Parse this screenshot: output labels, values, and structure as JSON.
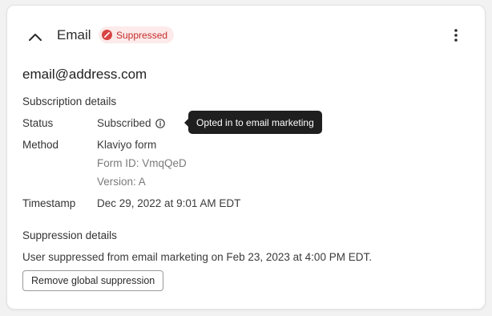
{
  "header": {
    "title": "Email",
    "badge_label": "Suppressed",
    "badge_color": "#c62c2c",
    "badge_background": "#fdeaea",
    "collapse_icon": "chevron-up-icon",
    "menu_icon": "more-vertical-icon"
  },
  "profile": {
    "email": "email@address.com"
  },
  "subscription": {
    "heading": "Subscription details",
    "status_label": "Status",
    "status_value": "Subscribed",
    "status_info_icon": "info-icon",
    "tooltip": "Opted in to email marketing",
    "method_label": "Method",
    "method_value": "Klaviyo form",
    "form_id": "Form ID: VmqQeD",
    "version": "Version: A",
    "timestamp_label": "Timestamp",
    "timestamp_value": "Dec 29, 2022 at 9:01 AM EDT"
  },
  "suppression": {
    "heading": "Suppression details",
    "message": "User suppressed from email marketing on Feb 23, 2023 at 4:00 PM EDT.",
    "remove_button_label": "Remove global suppression"
  }
}
